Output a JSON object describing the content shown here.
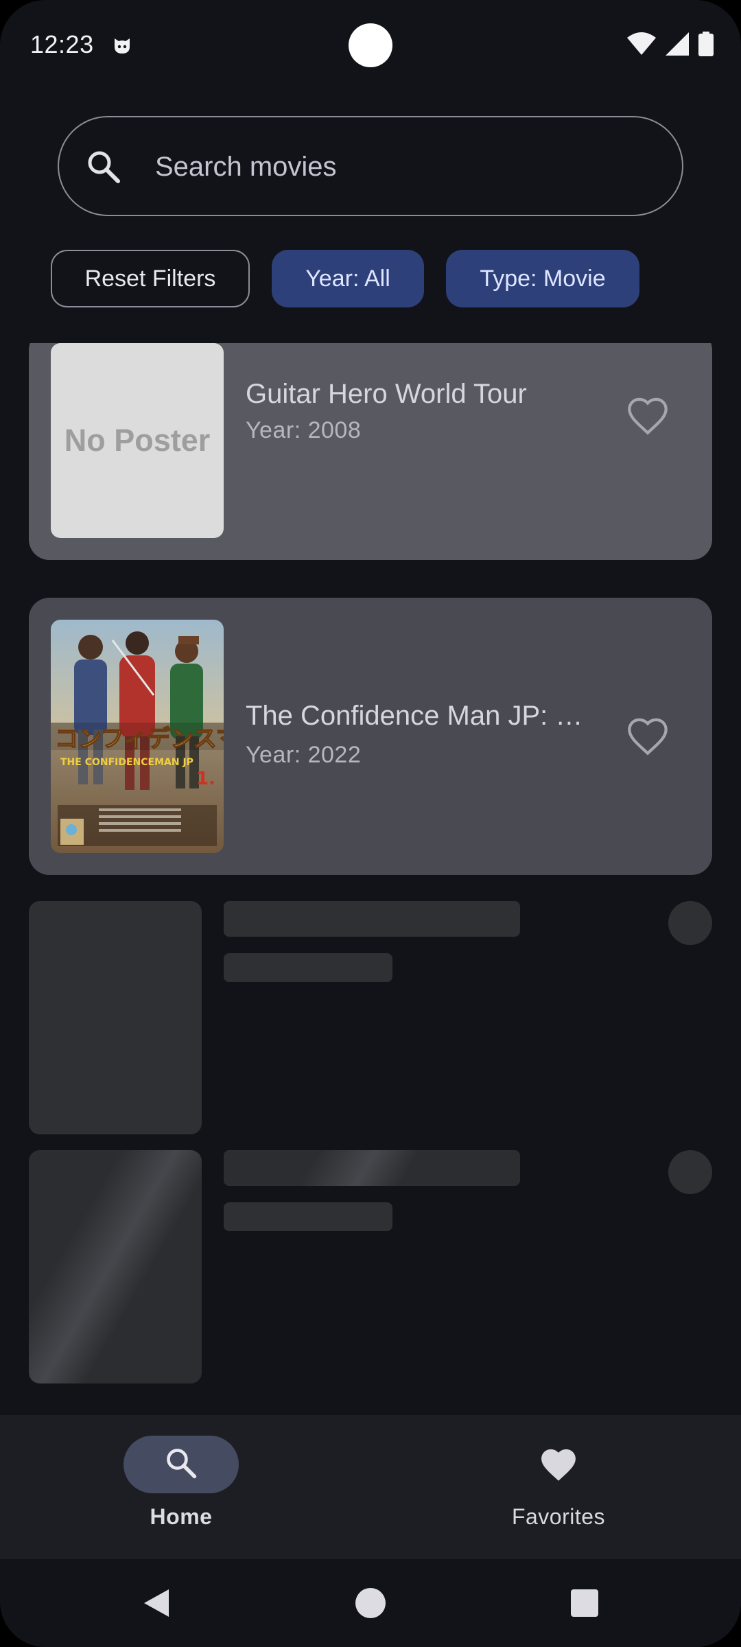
{
  "status_bar": {
    "time": "12:23",
    "icons": [
      "cat-notification-icon",
      "wifi-icon",
      "signal-icon",
      "battery-icon"
    ]
  },
  "search": {
    "placeholder": "Search movies",
    "value": "",
    "icon": "search-icon"
  },
  "filters": {
    "reset_label": "Reset Filters",
    "year_label": "Year: All",
    "type_label": "Type: Movie"
  },
  "movies": [
    {
      "title": "Guitar Hero World Tour",
      "year": "Year: 2008",
      "poster_placeholder": "No Poster",
      "favorite": false
    },
    {
      "title": "The Confidence Man JP: …",
      "year": "Year: 2022",
      "favorite": false
    }
  ],
  "bottom_nav": {
    "items": [
      {
        "label": "Home",
        "icon": "search-icon",
        "selected": true
      },
      {
        "label": "Favorites",
        "icon": "heart-filled-icon",
        "selected": false
      }
    ]
  },
  "colors": {
    "background": "#121318",
    "card": "#4a4a53",
    "chip_selected": "#2e4079",
    "nav_background": "#1d1e24",
    "nav_indicator": "#454b60"
  }
}
